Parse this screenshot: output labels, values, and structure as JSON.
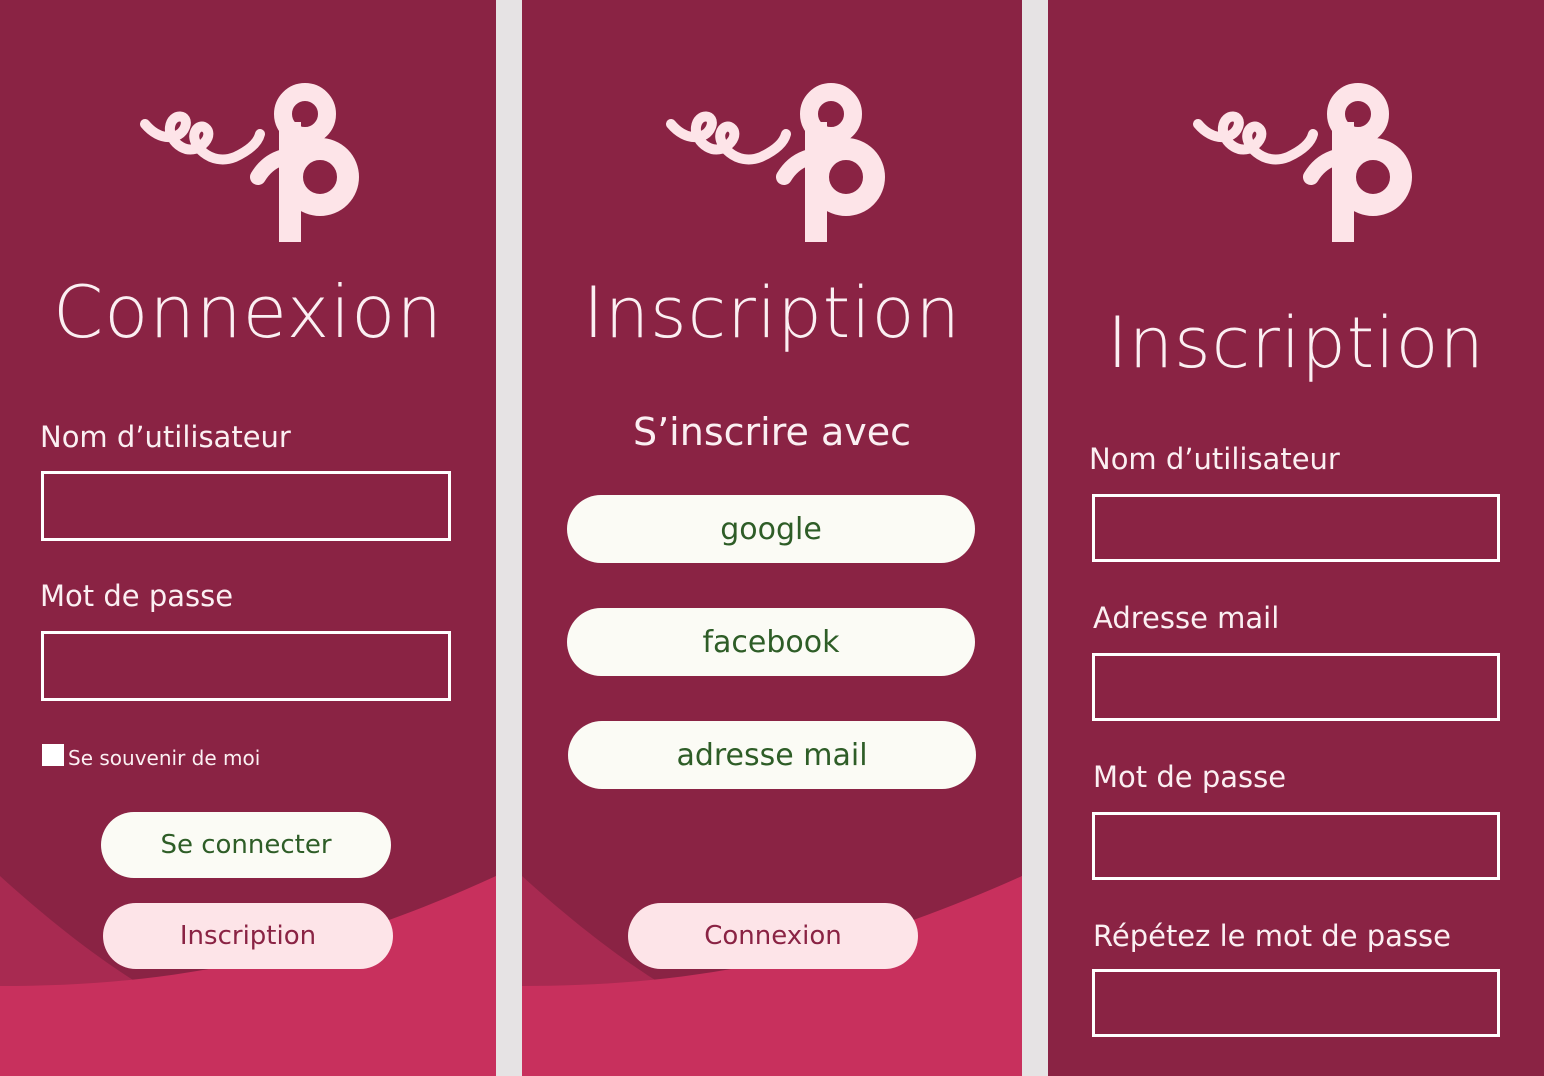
{
  "colors": {
    "panel_bg": "#8a2344",
    "wave_mid": "#a82a51",
    "wave_front": "#c8305d",
    "logo_pink": "#fde4e8",
    "button_light": "#fbfbf5",
    "button_pink": "#fde4e8",
    "button_text_green": "#2e5d27"
  },
  "login": {
    "title": "Connexion",
    "username_label": "Nom d’utilisateur",
    "password_label": "Mot de passe",
    "remember_label": "Se souvenir de moi",
    "submit_label": "Se connecter",
    "signup_label": "Inscription"
  },
  "signup_options": {
    "title": "Inscription",
    "subtitle": "S’inscrire avec",
    "google_label": "google",
    "facebook_label": "facebook",
    "email_label": "adresse mail",
    "login_label": "Connexion"
  },
  "signup_form": {
    "title": "Inscription",
    "username_label": "Nom d’utilisateur",
    "email_label": "Adresse mail",
    "password_label": "Mot de passe",
    "repeat_password_label": "Répétez le mot de passe"
  }
}
